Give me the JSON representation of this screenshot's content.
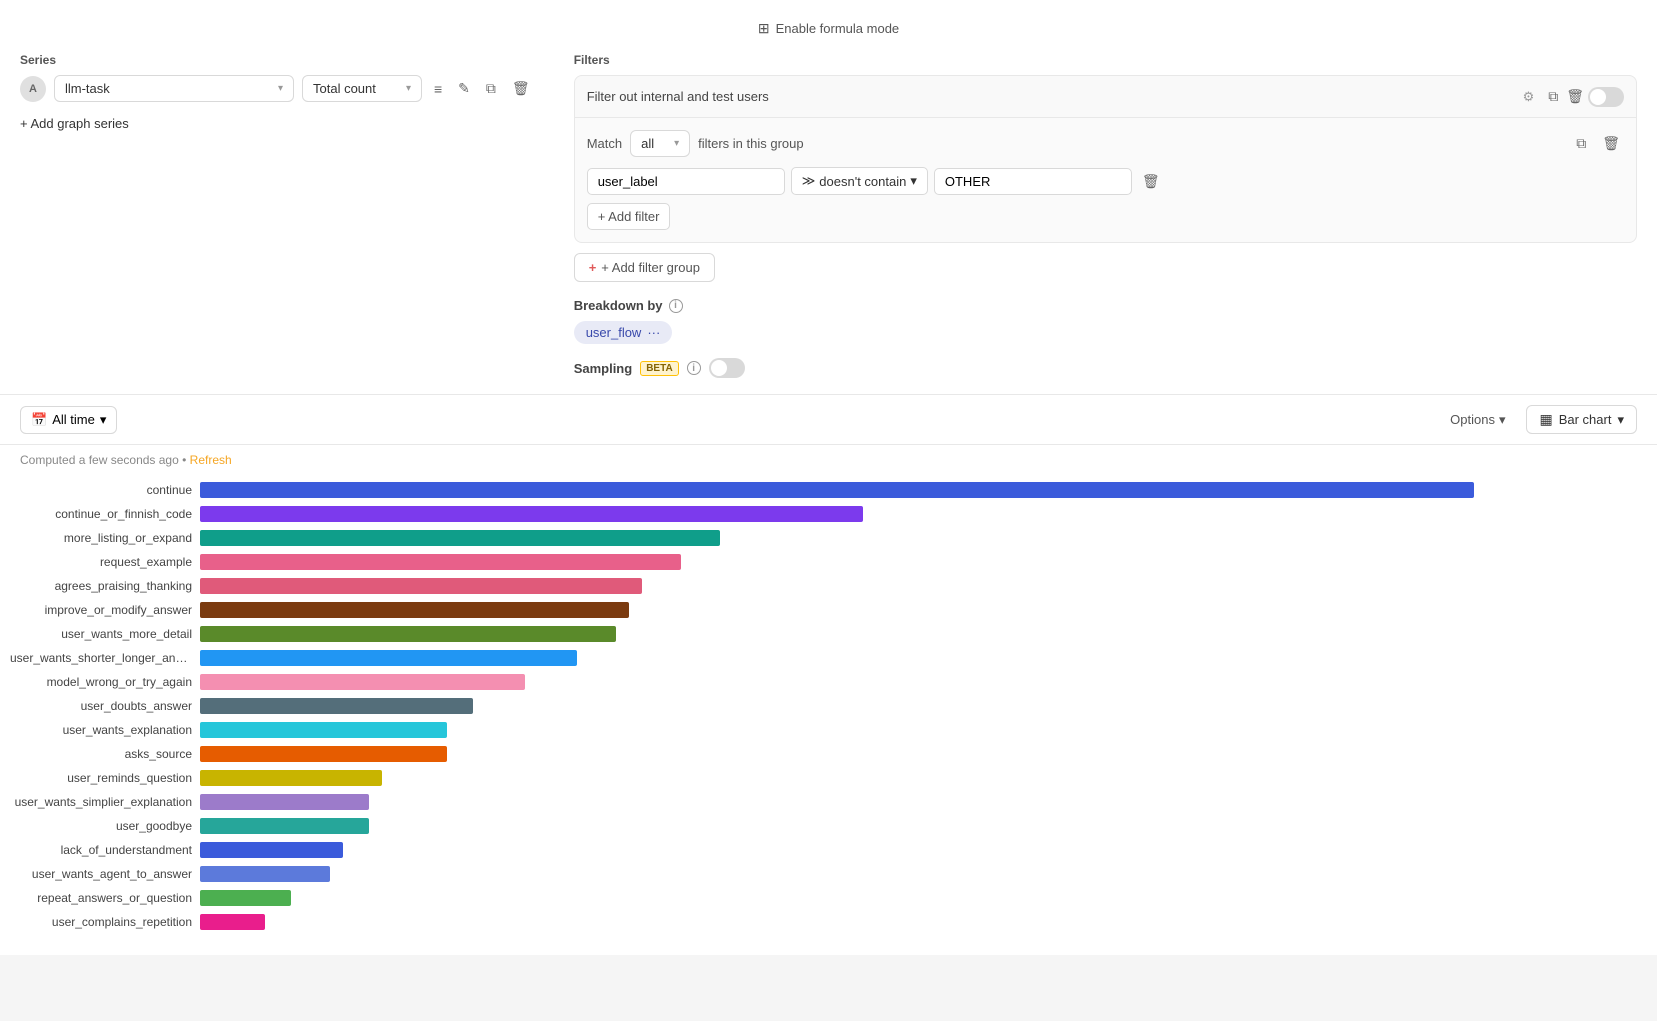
{
  "header": {
    "formula_btn": "Enable formula mode",
    "series_label": "Series",
    "filters_label": "Filters"
  },
  "series": {
    "avatar_letter": "A",
    "name": "llm-task",
    "count_label": "Total count",
    "add_series_label": "+ Add graph series"
  },
  "toolbar_icons": {
    "filter": "≡",
    "edit": "✎",
    "copy": "⧉",
    "delete": "🗑"
  },
  "filters": {
    "group_label": "Filter out internal and test users",
    "toggle_on": false,
    "match_label": "Match",
    "match_value": "all",
    "filters_in_group": "filters in this group",
    "field_value": "user_label",
    "op_icon": "≫",
    "op_value": "doesn't contain",
    "filter_value": "OTHER",
    "add_filter_label": "+ Add filter",
    "add_filter_group_label": "+ Add filter group"
  },
  "breakdown": {
    "label": "Breakdown by",
    "tag": "user_flow",
    "dots": "···"
  },
  "sampling": {
    "label": "Sampling",
    "beta": "BETA",
    "toggle_on": false
  },
  "chart_toolbar": {
    "time_label": "All time",
    "options_label": "Options",
    "chart_type_label": "Bar chart"
  },
  "computed": {
    "text": "Computed a few seconds ago",
    "separator": "•",
    "refresh": "Refresh"
  },
  "bars": [
    {
      "label": "continue",
      "color": "#3b5bdb",
      "width_pct": 98
    },
    {
      "label": "continue_or_finnish_code",
      "color": "#7c3aed",
      "width_pct": 51
    },
    {
      "label": "more_listing_or_expand",
      "color": "#0f9e8a",
      "width_pct": 40
    },
    {
      "label": "request_example",
      "color": "#e8608a",
      "width_pct": 37
    },
    {
      "label": "agrees_praising_thanking",
      "color": "#e05a7a",
      "width_pct": 34
    },
    {
      "label": "improve_or_modify_answer",
      "color": "#7b3b10",
      "width_pct": 33
    },
    {
      "label": "user_wants_more_detail",
      "color": "#5a8a2a",
      "width_pct": 32
    },
    {
      "label": "user_wants_shorter_longer_answer",
      "color": "#2196f3",
      "width_pct": 29
    },
    {
      "label": "model_wrong_or_try_again",
      "color": "#f48fb1",
      "width_pct": 25
    },
    {
      "label": "user_doubts_answer",
      "color": "#546e7a",
      "width_pct": 21
    },
    {
      "label": "user_wants_explanation",
      "color": "#26c6da",
      "width_pct": 19
    },
    {
      "label": "asks_source",
      "color": "#e65c00",
      "width_pct": 19
    },
    {
      "label": "user_reminds_question",
      "color": "#c8b400",
      "width_pct": 14
    },
    {
      "label": "user_wants_simplier_explanation",
      "color": "#9c7bca",
      "width_pct": 13
    },
    {
      "label": "user_goodbye",
      "color": "#26a69a",
      "width_pct": 13
    },
    {
      "label": "lack_of_understandment",
      "color": "#3b5bdb",
      "width_pct": 11
    },
    {
      "label": "user_wants_agent_to_answer",
      "color": "#5c7adb",
      "width_pct": 10
    },
    {
      "label": "repeat_answers_or_question",
      "color": "#4caf50",
      "width_pct": 7
    },
    {
      "label": "user_complains_repetition",
      "color": "#e91e8c",
      "width_pct": 5
    }
  ]
}
